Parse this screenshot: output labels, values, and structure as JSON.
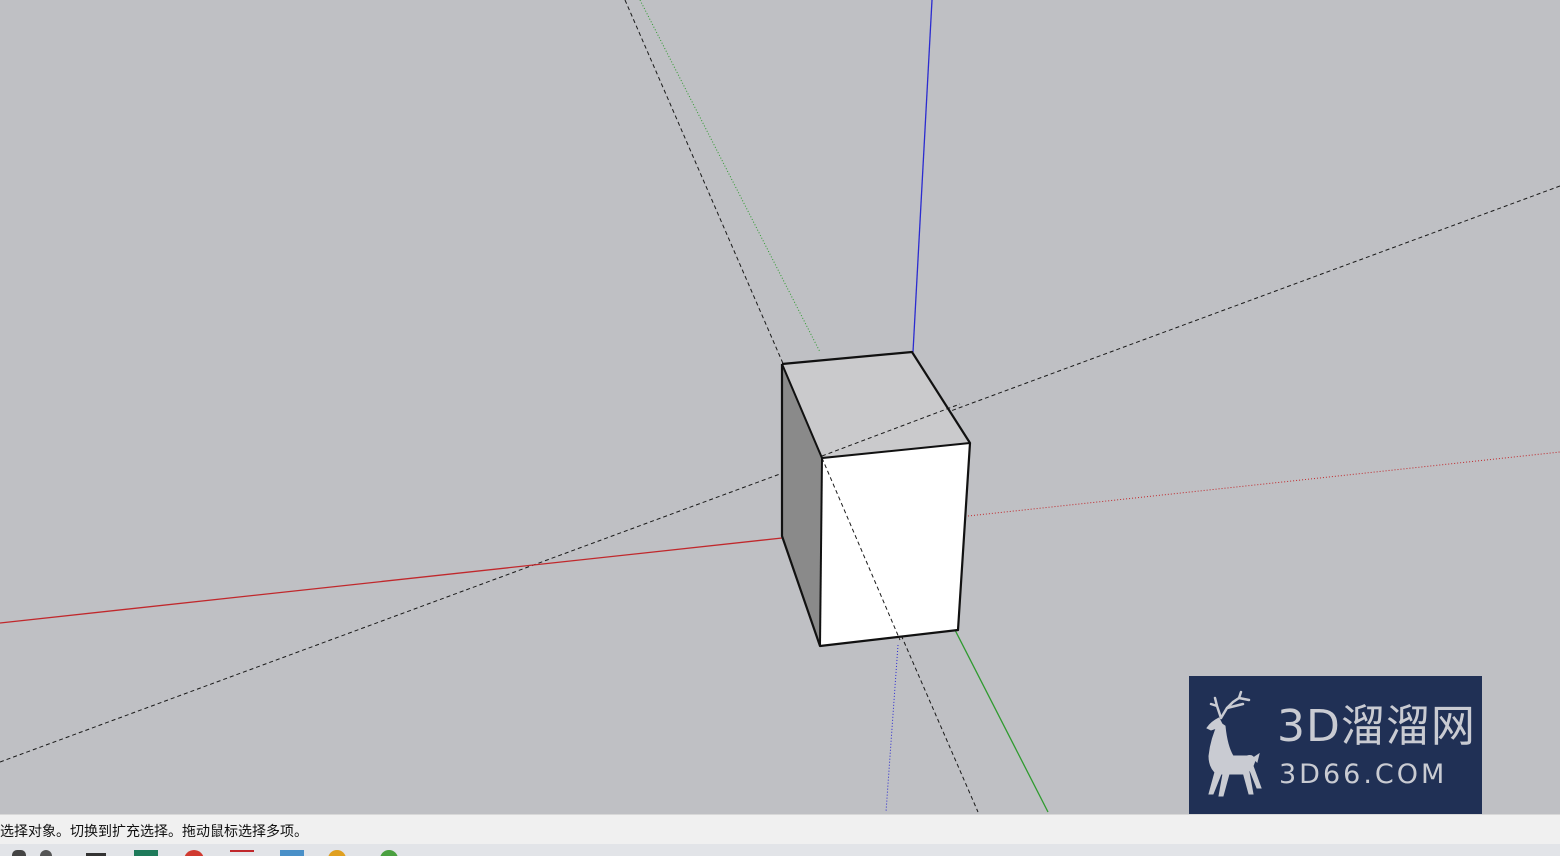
{
  "viewport": {
    "background": "#bfc0c4",
    "axis_colors": {
      "red": "#c0282c",
      "green": "#2f9a2f",
      "blue": "#2b2bd0"
    },
    "model": "box"
  },
  "watermark": {
    "brand_cn": "3D溜溜网",
    "brand_domain": "3D66.COM",
    "logo": "deer-icon",
    "background": "#203055"
  },
  "status_bar": {
    "message": "选择对象。切换到扩充选择。拖动鼠标选择多项。"
  },
  "taskbar": {
    "icons": [
      "app-icon-1",
      "app-icon-2",
      "app-icon-3",
      "app-icon-4",
      "app-icon-5",
      "app-icon-6",
      "app-icon-7",
      "app-icon-8"
    ]
  }
}
